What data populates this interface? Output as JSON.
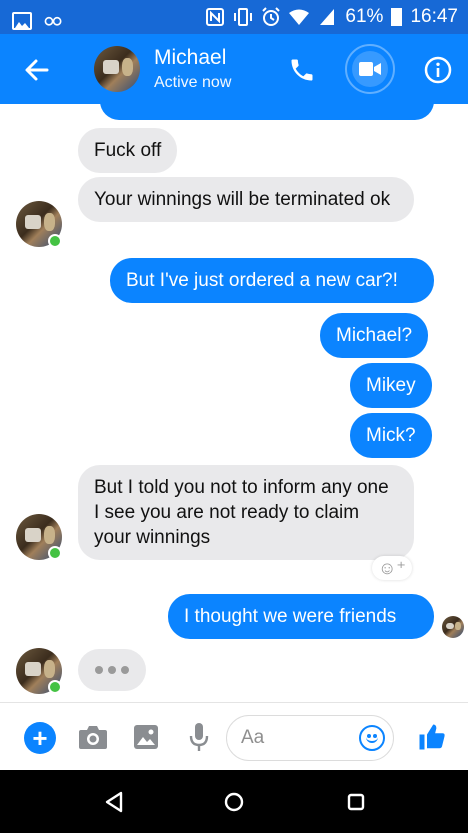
{
  "statusbar": {
    "battery": "61%",
    "time": "16:47"
  },
  "header": {
    "name": "Michael",
    "status": "Active now"
  },
  "messages": [
    {
      "from": "them",
      "text": "Fuck off"
    },
    {
      "from": "them",
      "text": "Your winnings will be terminated ok"
    },
    {
      "from": "me",
      "text": "But I've just ordered a new car?!"
    },
    {
      "from": "me",
      "text": "Michael?"
    },
    {
      "from": "me",
      "text": "Mikey"
    },
    {
      "from": "me",
      "text": "Mick?"
    },
    {
      "from": "them",
      "text": "But I told you not to inform any one I see you are not ready to claim your winnings"
    },
    {
      "from": "me",
      "text": "I thought we were friends"
    }
  ],
  "composer": {
    "placeholder": "Aa"
  },
  "colors": {
    "messenger_blue": "#0b84ff",
    "statusbar_blue": "#1769d6",
    "incoming_bubble": "#e9e9eb",
    "online_green": "#44c243"
  },
  "icons": {
    "header": [
      "back-arrow-icon",
      "phone-icon",
      "video-camera-icon",
      "info-icon"
    ],
    "composer": [
      "plus-icon",
      "camera-icon",
      "image-icon",
      "microphone-icon",
      "emoji-icon",
      "thumbs-up-icon"
    ],
    "navigation": [
      "nav-back-icon",
      "nav-home-icon",
      "nav-recents-icon"
    ]
  }
}
